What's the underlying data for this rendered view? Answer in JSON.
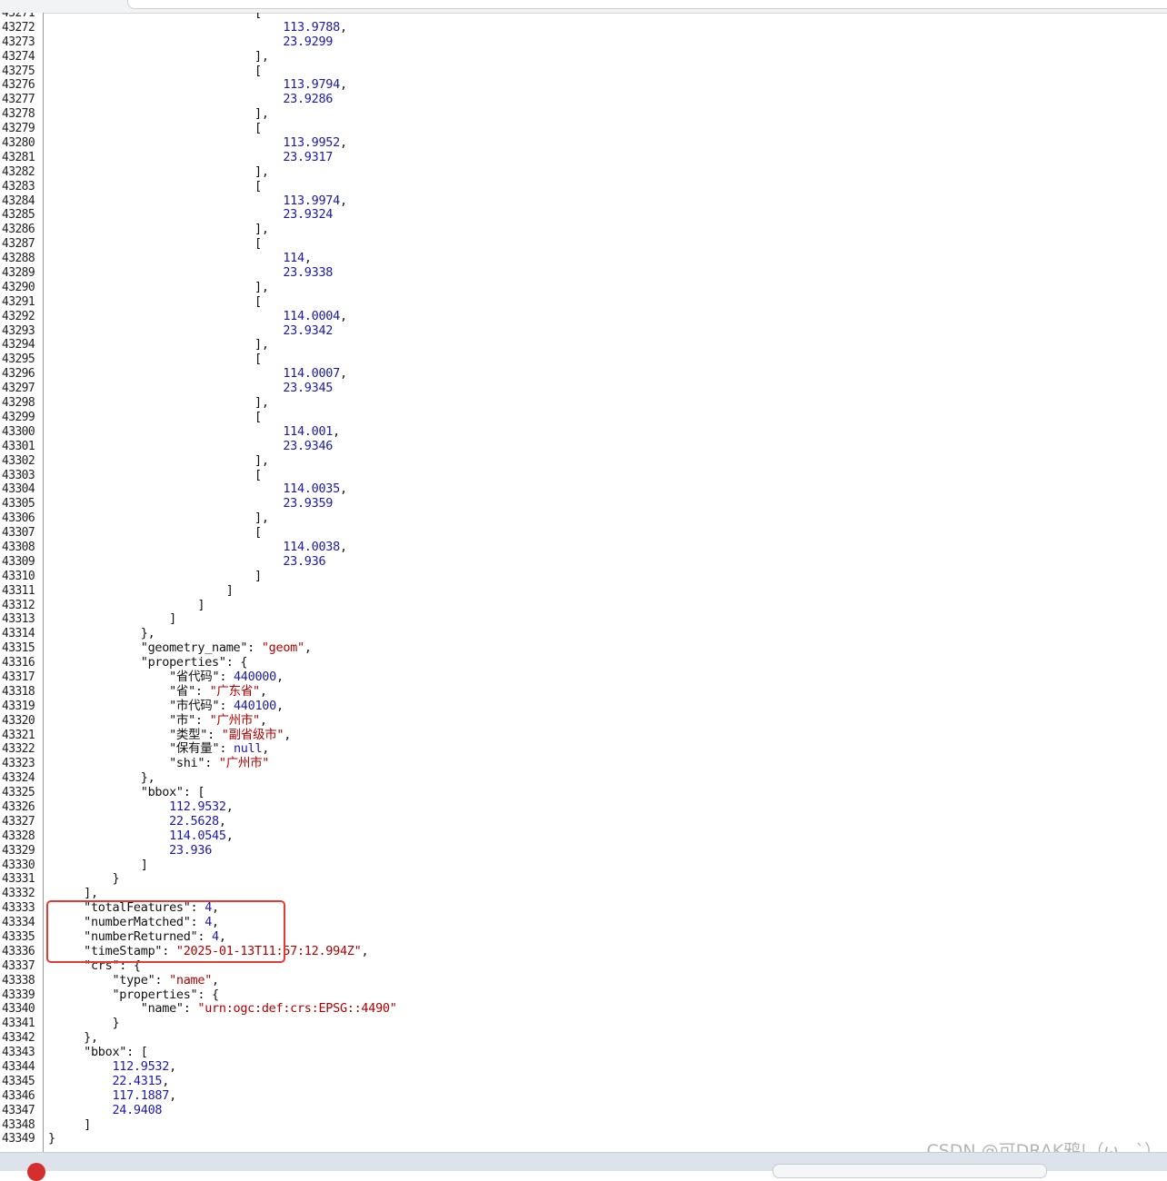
{
  "viewer": {
    "lines": [
      {
        "n": "43271",
        "t": [
          {
            "s": "                             [",
            "c": "pun"
          }
        ]
      },
      {
        "n": "43272",
        "t": [
          {
            "s": "                                 ",
            "c": "pun"
          },
          {
            "s": "113.9788",
            "c": "num"
          },
          {
            "s": ",",
            "c": "pun"
          }
        ]
      },
      {
        "n": "43273",
        "t": [
          {
            "s": "                                 ",
            "c": "pun"
          },
          {
            "s": "23.9299",
            "c": "num"
          }
        ]
      },
      {
        "n": "43274",
        "t": [
          {
            "s": "                             ],",
            "c": "pun"
          }
        ]
      },
      {
        "n": "43275",
        "t": [
          {
            "s": "                             [",
            "c": "pun"
          }
        ]
      },
      {
        "n": "43276",
        "t": [
          {
            "s": "                                 ",
            "c": "pun"
          },
          {
            "s": "113.9794",
            "c": "num"
          },
          {
            "s": ",",
            "c": "pun"
          }
        ]
      },
      {
        "n": "43277",
        "t": [
          {
            "s": "                                 ",
            "c": "pun"
          },
          {
            "s": "23.9286",
            "c": "num"
          }
        ]
      },
      {
        "n": "43278",
        "t": [
          {
            "s": "                             ],",
            "c": "pun"
          }
        ]
      },
      {
        "n": "43279",
        "t": [
          {
            "s": "                             [",
            "c": "pun"
          }
        ]
      },
      {
        "n": "43280",
        "t": [
          {
            "s": "                                 ",
            "c": "pun"
          },
          {
            "s": "113.9952",
            "c": "num"
          },
          {
            "s": ",",
            "c": "pun"
          }
        ]
      },
      {
        "n": "43281",
        "t": [
          {
            "s": "                                 ",
            "c": "pun"
          },
          {
            "s": "23.9317",
            "c": "num"
          }
        ]
      },
      {
        "n": "43282",
        "t": [
          {
            "s": "                             ],",
            "c": "pun"
          }
        ]
      },
      {
        "n": "43283",
        "t": [
          {
            "s": "                             [",
            "c": "pun"
          }
        ]
      },
      {
        "n": "43284",
        "t": [
          {
            "s": "                                 ",
            "c": "pun"
          },
          {
            "s": "113.9974",
            "c": "num"
          },
          {
            "s": ",",
            "c": "pun"
          }
        ]
      },
      {
        "n": "43285",
        "t": [
          {
            "s": "                                 ",
            "c": "pun"
          },
          {
            "s": "23.9324",
            "c": "num"
          }
        ]
      },
      {
        "n": "43286",
        "t": [
          {
            "s": "                             ],",
            "c": "pun"
          }
        ]
      },
      {
        "n": "43287",
        "t": [
          {
            "s": "                             [",
            "c": "pun"
          }
        ]
      },
      {
        "n": "43288",
        "t": [
          {
            "s": "                                 ",
            "c": "pun"
          },
          {
            "s": "114",
            "c": "num"
          },
          {
            "s": ",",
            "c": "pun"
          }
        ]
      },
      {
        "n": "43289",
        "t": [
          {
            "s": "                                 ",
            "c": "pun"
          },
          {
            "s": "23.9338",
            "c": "num"
          }
        ]
      },
      {
        "n": "43290",
        "t": [
          {
            "s": "                             ],",
            "c": "pun"
          }
        ]
      },
      {
        "n": "43291",
        "t": [
          {
            "s": "                             [",
            "c": "pun"
          }
        ]
      },
      {
        "n": "43292",
        "t": [
          {
            "s": "                                 ",
            "c": "pun"
          },
          {
            "s": "114.0004",
            "c": "num"
          },
          {
            "s": ",",
            "c": "pun"
          }
        ]
      },
      {
        "n": "43293",
        "t": [
          {
            "s": "                                 ",
            "c": "pun"
          },
          {
            "s": "23.9342",
            "c": "num"
          }
        ]
      },
      {
        "n": "43294",
        "t": [
          {
            "s": "                             ],",
            "c": "pun"
          }
        ]
      },
      {
        "n": "43295",
        "t": [
          {
            "s": "                             [",
            "c": "pun"
          }
        ]
      },
      {
        "n": "43296",
        "t": [
          {
            "s": "                                 ",
            "c": "pun"
          },
          {
            "s": "114.0007",
            "c": "num"
          },
          {
            "s": ",",
            "c": "pun"
          }
        ]
      },
      {
        "n": "43297",
        "t": [
          {
            "s": "                                 ",
            "c": "pun"
          },
          {
            "s": "23.9345",
            "c": "num"
          }
        ]
      },
      {
        "n": "43298",
        "t": [
          {
            "s": "                             ],",
            "c": "pun"
          }
        ]
      },
      {
        "n": "43299",
        "t": [
          {
            "s": "                             [",
            "c": "pun"
          }
        ]
      },
      {
        "n": "43300",
        "t": [
          {
            "s": "                                 ",
            "c": "pun"
          },
          {
            "s": "114.001",
            "c": "num"
          },
          {
            "s": ",",
            "c": "pun"
          }
        ]
      },
      {
        "n": "43301",
        "t": [
          {
            "s": "                                 ",
            "c": "pun"
          },
          {
            "s": "23.9346",
            "c": "num"
          }
        ]
      },
      {
        "n": "43302",
        "t": [
          {
            "s": "                             ],",
            "c": "pun"
          }
        ]
      },
      {
        "n": "43303",
        "t": [
          {
            "s": "                             [",
            "c": "pun"
          }
        ]
      },
      {
        "n": "43304",
        "t": [
          {
            "s": "                                 ",
            "c": "pun"
          },
          {
            "s": "114.0035",
            "c": "num"
          },
          {
            "s": ",",
            "c": "pun"
          }
        ]
      },
      {
        "n": "43305",
        "t": [
          {
            "s": "                                 ",
            "c": "pun"
          },
          {
            "s": "23.9359",
            "c": "num"
          }
        ]
      },
      {
        "n": "43306",
        "t": [
          {
            "s": "                             ],",
            "c": "pun"
          }
        ]
      },
      {
        "n": "43307",
        "t": [
          {
            "s": "                             [",
            "c": "pun"
          }
        ]
      },
      {
        "n": "43308",
        "t": [
          {
            "s": "                                 ",
            "c": "pun"
          },
          {
            "s": "114.0038",
            "c": "num"
          },
          {
            "s": ",",
            "c": "pun"
          }
        ]
      },
      {
        "n": "43309",
        "t": [
          {
            "s": "                                 ",
            "c": "pun"
          },
          {
            "s": "23.936",
            "c": "num"
          }
        ]
      },
      {
        "n": "43310",
        "t": [
          {
            "s": "                             ]",
            "c": "pun"
          }
        ]
      },
      {
        "n": "43311",
        "t": [
          {
            "s": "                         ]",
            "c": "pun"
          }
        ]
      },
      {
        "n": "43312",
        "t": [
          {
            "s": "                     ]",
            "c": "pun"
          }
        ]
      },
      {
        "n": "43313",
        "t": [
          {
            "s": "                 ]",
            "c": "pun"
          }
        ]
      },
      {
        "n": "43314",
        "t": [
          {
            "s": "             },",
            "c": "pun"
          }
        ]
      },
      {
        "n": "43315",
        "t": [
          {
            "s": "             \"geometry_name\": ",
            "c": "key"
          },
          {
            "s": "\"geom\"",
            "c": "str"
          },
          {
            "s": ",",
            "c": "pun"
          }
        ]
      },
      {
        "n": "43316",
        "t": [
          {
            "s": "             \"properties\": {",
            "c": "key"
          }
        ]
      },
      {
        "n": "43317",
        "t": [
          {
            "s": "                 \"省代码\": ",
            "c": "key"
          },
          {
            "s": "440000",
            "c": "num"
          },
          {
            "s": ",",
            "c": "pun"
          }
        ]
      },
      {
        "n": "43318",
        "t": [
          {
            "s": "                 \"省\": ",
            "c": "key"
          },
          {
            "s": "\"广东省\"",
            "c": "str"
          },
          {
            "s": ",",
            "c": "pun"
          }
        ]
      },
      {
        "n": "43319",
        "t": [
          {
            "s": "                 \"市代码\": ",
            "c": "key"
          },
          {
            "s": "440100",
            "c": "num"
          },
          {
            "s": ",",
            "c": "pun"
          }
        ]
      },
      {
        "n": "43320",
        "t": [
          {
            "s": "                 \"市\": ",
            "c": "key"
          },
          {
            "s": "\"广州市\"",
            "c": "str"
          },
          {
            "s": ",",
            "c": "pun"
          }
        ]
      },
      {
        "n": "43321",
        "t": [
          {
            "s": "                 \"类型\": ",
            "c": "key"
          },
          {
            "s": "\"副省级市\"",
            "c": "str"
          },
          {
            "s": ",",
            "c": "pun"
          }
        ]
      },
      {
        "n": "43322",
        "t": [
          {
            "s": "                 \"保有量\": ",
            "c": "key"
          },
          {
            "s": "null",
            "c": "num"
          },
          {
            "s": ",",
            "c": "pun"
          }
        ]
      },
      {
        "n": "43323",
        "t": [
          {
            "s": "                 \"shi\": ",
            "c": "key"
          },
          {
            "s": "\"广州市\"",
            "c": "str"
          }
        ]
      },
      {
        "n": "43324",
        "t": [
          {
            "s": "             },",
            "c": "pun"
          }
        ]
      },
      {
        "n": "43325",
        "t": [
          {
            "s": "             \"bbox\": [",
            "c": "key"
          }
        ]
      },
      {
        "n": "43326",
        "t": [
          {
            "s": "                 ",
            "c": "pun"
          },
          {
            "s": "112.9532",
            "c": "num"
          },
          {
            "s": ",",
            "c": "pun"
          }
        ]
      },
      {
        "n": "43327",
        "t": [
          {
            "s": "                 ",
            "c": "pun"
          },
          {
            "s": "22.5628",
            "c": "num"
          },
          {
            "s": ",",
            "c": "pun"
          }
        ]
      },
      {
        "n": "43328",
        "t": [
          {
            "s": "                 ",
            "c": "pun"
          },
          {
            "s": "114.0545",
            "c": "num"
          },
          {
            "s": ",",
            "c": "pun"
          }
        ]
      },
      {
        "n": "43329",
        "t": [
          {
            "s": "                 ",
            "c": "pun"
          },
          {
            "s": "23.936",
            "c": "num"
          }
        ]
      },
      {
        "n": "43330",
        "t": [
          {
            "s": "             ]",
            "c": "pun"
          }
        ]
      },
      {
        "n": "43331",
        "t": [
          {
            "s": "         }",
            "c": "pun"
          }
        ]
      },
      {
        "n": "43332",
        "t": [
          {
            "s": "     ],",
            "c": "pun"
          }
        ]
      },
      {
        "n": "43333",
        "t": [
          {
            "s": "     \"totalFeatures\": ",
            "c": "key"
          },
          {
            "s": "4",
            "c": "num"
          },
          {
            "s": ",",
            "c": "pun"
          }
        ]
      },
      {
        "n": "43334",
        "t": [
          {
            "s": "     \"numberMatched\": ",
            "c": "key"
          },
          {
            "s": "4",
            "c": "num"
          },
          {
            "s": ",",
            "c": "pun"
          }
        ]
      },
      {
        "n": "43335",
        "t": [
          {
            "s": "     \"numberReturned\": ",
            "c": "key"
          },
          {
            "s": "4",
            "c": "num"
          },
          {
            "s": ",",
            "c": "pun"
          }
        ]
      },
      {
        "n": "43336",
        "t": [
          {
            "s": "     \"timeStamp\": ",
            "c": "key"
          },
          {
            "s": "\"2025-01-13T11:57:12.994Z\"",
            "c": "str"
          },
          {
            "s": ",",
            "c": "pun"
          }
        ]
      },
      {
        "n": "43337",
        "t": [
          {
            "s": "     \"crs\": {",
            "c": "key"
          }
        ]
      },
      {
        "n": "43338",
        "t": [
          {
            "s": "         \"type\": ",
            "c": "key"
          },
          {
            "s": "\"name\"",
            "c": "str"
          },
          {
            "s": ",",
            "c": "pun"
          }
        ]
      },
      {
        "n": "43339",
        "t": [
          {
            "s": "         \"properties\": {",
            "c": "key"
          }
        ]
      },
      {
        "n": "43340",
        "t": [
          {
            "s": "             \"name\": ",
            "c": "key"
          },
          {
            "s": "\"urn:ogc:def:crs:EPSG::4490\"",
            "c": "str"
          }
        ]
      },
      {
        "n": "43341",
        "t": [
          {
            "s": "         }",
            "c": "pun"
          }
        ]
      },
      {
        "n": "43342",
        "t": [
          {
            "s": "     },",
            "c": "pun"
          }
        ]
      },
      {
        "n": "43343",
        "t": [
          {
            "s": "     \"bbox\": [",
            "c": "key"
          }
        ]
      },
      {
        "n": "43344",
        "t": [
          {
            "s": "         ",
            "c": "pun"
          },
          {
            "s": "112.9532",
            "c": "num"
          },
          {
            "s": ",",
            "c": "pun"
          }
        ]
      },
      {
        "n": "43345",
        "t": [
          {
            "s": "         ",
            "c": "pun"
          },
          {
            "s": "22.4315",
            "c": "num"
          },
          {
            "s": ",",
            "c": "pun"
          }
        ]
      },
      {
        "n": "43346",
        "t": [
          {
            "s": "         ",
            "c": "pun"
          },
          {
            "s": "117.1887",
            "c": "num"
          },
          {
            "s": ",",
            "c": "pun"
          }
        ]
      },
      {
        "n": "43347",
        "t": [
          {
            "s": "         ",
            "c": "pun"
          },
          {
            "s": "24.9408",
            "c": "num"
          }
        ]
      },
      {
        "n": "43348",
        "t": [
          {
            "s": "     ]",
            "c": "pun"
          }
        ]
      },
      {
        "n": "43349",
        "t": [
          {
            "s": "}",
            "c": "pun"
          }
        ]
      }
    ]
  },
  "highlight": {
    "color": "#e53935"
  },
  "watermark": "CSDN @可DRAK鸦|（ω　`）",
  "colors": {
    "number": "#1a1aa6",
    "string": "#b00000",
    "text": "#111111",
    "gutter_border": "#9a9a9a"
  }
}
